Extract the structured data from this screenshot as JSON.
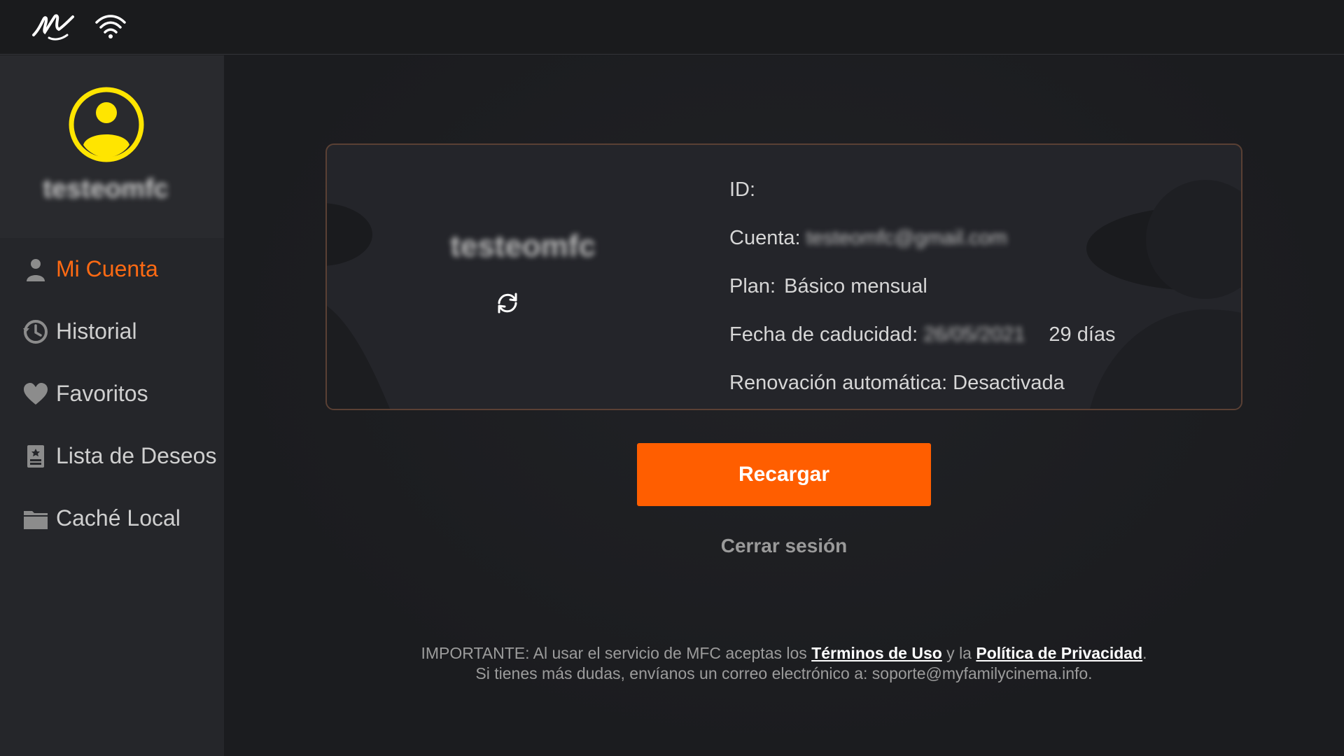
{
  "sidebar": {
    "username": "testeomfc",
    "items": [
      {
        "label": "Mi Cuenta",
        "icon": "user-icon",
        "active": true
      },
      {
        "label": "Historial",
        "icon": "history-icon",
        "active": false
      },
      {
        "label": "Favoritos",
        "icon": "heart-icon",
        "active": false
      },
      {
        "label": "Lista de Deseos",
        "icon": "wishlist-icon",
        "active": false
      },
      {
        "label": "Caché Local",
        "icon": "folder-icon",
        "active": false
      }
    ]
  },
  "account": {
    "username": "testeomfc",
    "id_label": "ID:",
    "id_value": "",
    "account_label": "Cuenta:",
    "account_value": "testeomfc@gmail.com",
    "plan_label": "Plan:",
    "plan_value": "Básico mensual",
    "expiry_label": "Fecha de caducidad:",
    "expiry_value": "26/05/2021",
    "days_left": "29 días",
    "renewal_label": "Renovación automática:",
    "renewal_value": "Desactivada"
  },
  "actions": {
    "reload_label": "Recargar",
    "logout_label": "Cerrar sesión"
  },
  "footer": {
    "line1_prefix": "IMPORTANTE: Al usar el servicio de MFC aceptas los ",
    "terms_link": "Términos de Uso",
    "line1_mid": " y la ",
    "privacy_link": "Política de Privacidad",
    "line1_suffix": ".",
    "line2": "Si tienes más dudas, envíanos un correo electrónico a: soporte@myfamilycinema.info."
  },
  "colors": {
    "accent": "#ff5e00",
    "active_text": "#ff6a13",
    "avatar": "#ffe500"
  }
}
